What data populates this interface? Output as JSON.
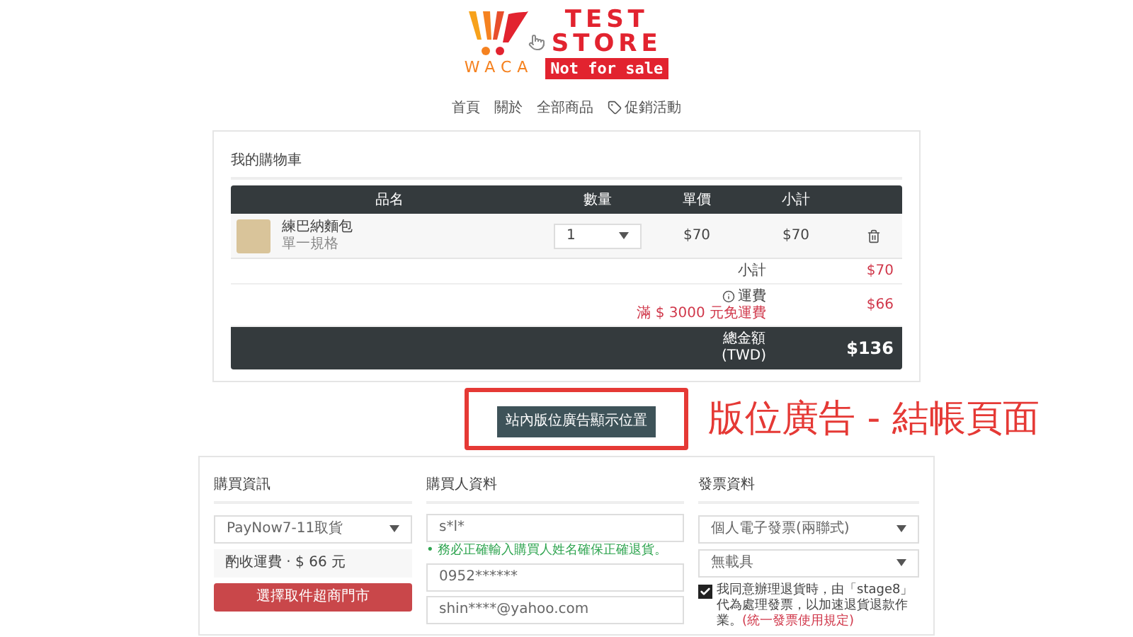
{
  "logo": {
    "mark": "WACA",
    "title_lines": [
      "TEST",
      "STORE"
    ],
    "badge": "Not for sale"
  },
  "nav": [
    {
      "label": "首頁",
      "kind": "text"
    },
    {
      "label": "關於",
      "kind": "text"
    },
    {
      "label": "全部商品",
      "kind": "text"
    },
    {
      "label": "促銷活動",
      "kind": "tag"
    }
  ],
  "cart": {
    "title": "我的購物車",
    "columns": [
      "品名",
      "數量",
      "單價",
      "小計"
    ],
    "items": [
      {
        "name": "練巴納麵包",
        "variant": "單一規格",
        "quantity": "1",
        "unit_price": "$70",
        "subtotal": "$70"
      }
    ],
    "subtotal": {
      "label": "小計",
      "value": "$70"
    },
    "shipping": {
      "label": "運費",
      "note": "滿 $ 3000 元免運費",
      "value": "$66"
    },
    "total": {
      "label": "總金額",
      "currency": "(TWD)",
      "value": "$136"
    }
  },
  "ad": {
    "button": "站內版位廣告顯示位置",
    "caption": "版位廣告 - 結帳頁面"
  },
  "purchase": {
    "title": "購買資訊",
    "method": "PayNow7-11取貨",
    "fee": "酌收運費 ‧ $ 66 元",
    "store_button": "選擇取件超商門市"
  },
  "buyer": {
    "title": "購買人資料",
    "fields": [
      {
        "value": "s*l*",
        "hint": "• 務必正確輸入購買人姓名確保正確退貨。"
      },
      {
        "value": "0952******"
      },
      {
        "value": "shin****@yahoo.com"
      }
    ]
  },
  "invoice": {
    "title": "發票資料",
    "selects": [
      "個人電子發票(兩聯式)",
      "無載具"
    ],
    "agree": {
      "checked": true,
      "text": "我同意辦理退貨時，由「stage8」代為處理發票，以加速退貨退款作業。",
      "link": "(統一發票使用規定)"
    }
  }
}
